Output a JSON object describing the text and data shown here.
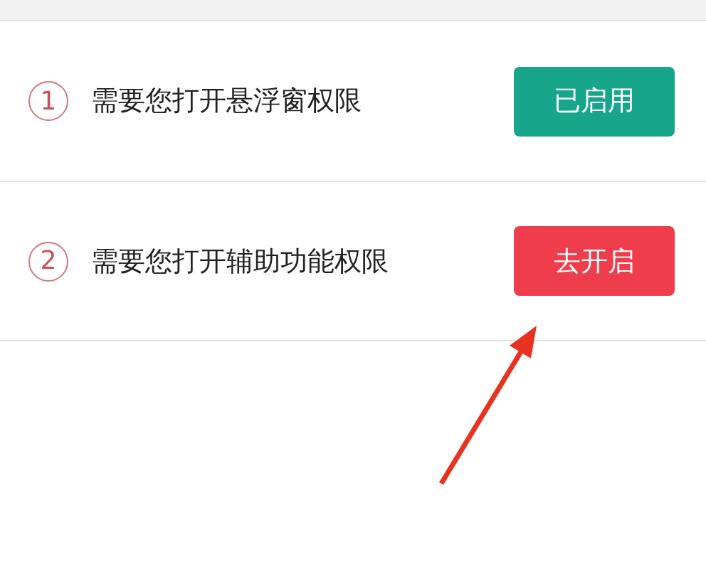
{
  "permissions": [
    {
      "number": "1",
      "text": "需要您打开悬浮窗权限",
      "button": {
        "label": "已启用",
        "granted": true
      }
    },
    {
      "number": "2",
      "text": "需要您打开辅助功能权限",
      "button": {
        "label": "去开启",
        "granted": false
      }
    }
  ]
}
